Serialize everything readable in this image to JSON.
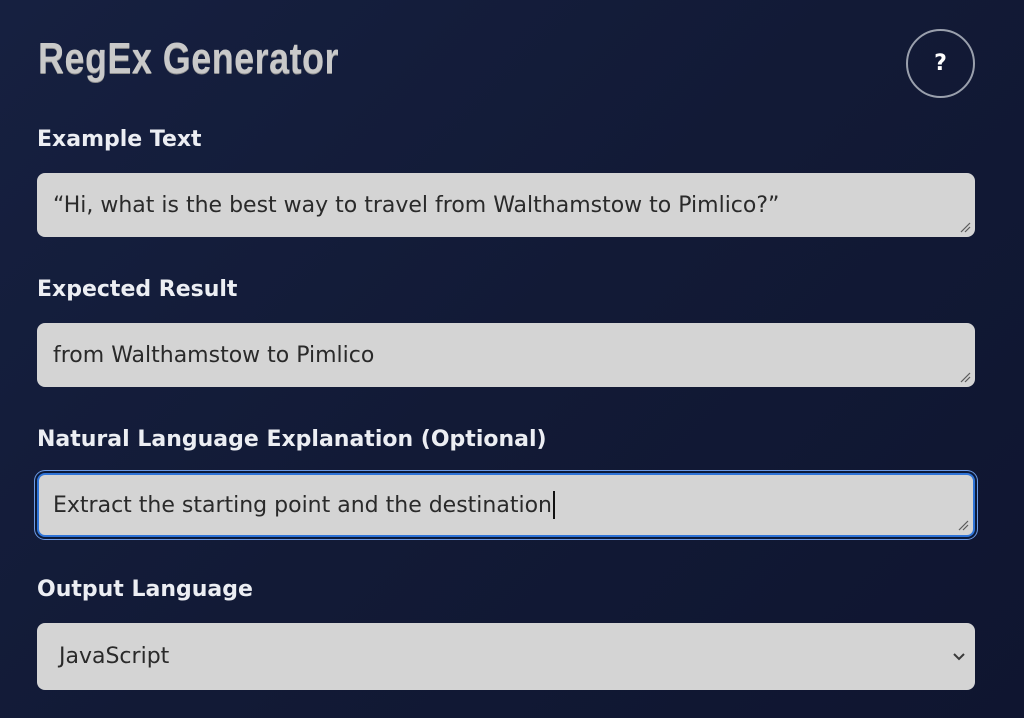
{
  "header": {
    "title": "RegEx Generator",
    "help_label": "?"
  },
  "form": {
    "example_text": {
      "label": "Example Text",
      "value": "“Hi, what is the best way to travel from Walthamstow to Pimlico?”"
    },
    "expected_result": {
      "label": "Expected Result",
      "value": "from Walthamstow to Pimlico"
    },
    "explanation": {
      "label": "Natural Language Explanation (Optional)",
      "value": "Extract the starting point and the destination"
    },
    "output_language": {
      "label": "Output Language",
      "selected": "JavaScript"
    }
  },
  "icons": {
    "help": "question-mark-icon",
    "resize": "resize-grip-icon",
    "dropdown": "chevron-down-icon"
  },
  "colors": {
    "background": "#131b38",
    "field_bg": "#d4d4d4",
    "focus_ring": "#2f74d8",
    "title": "#c9c9c9"
  }
}
